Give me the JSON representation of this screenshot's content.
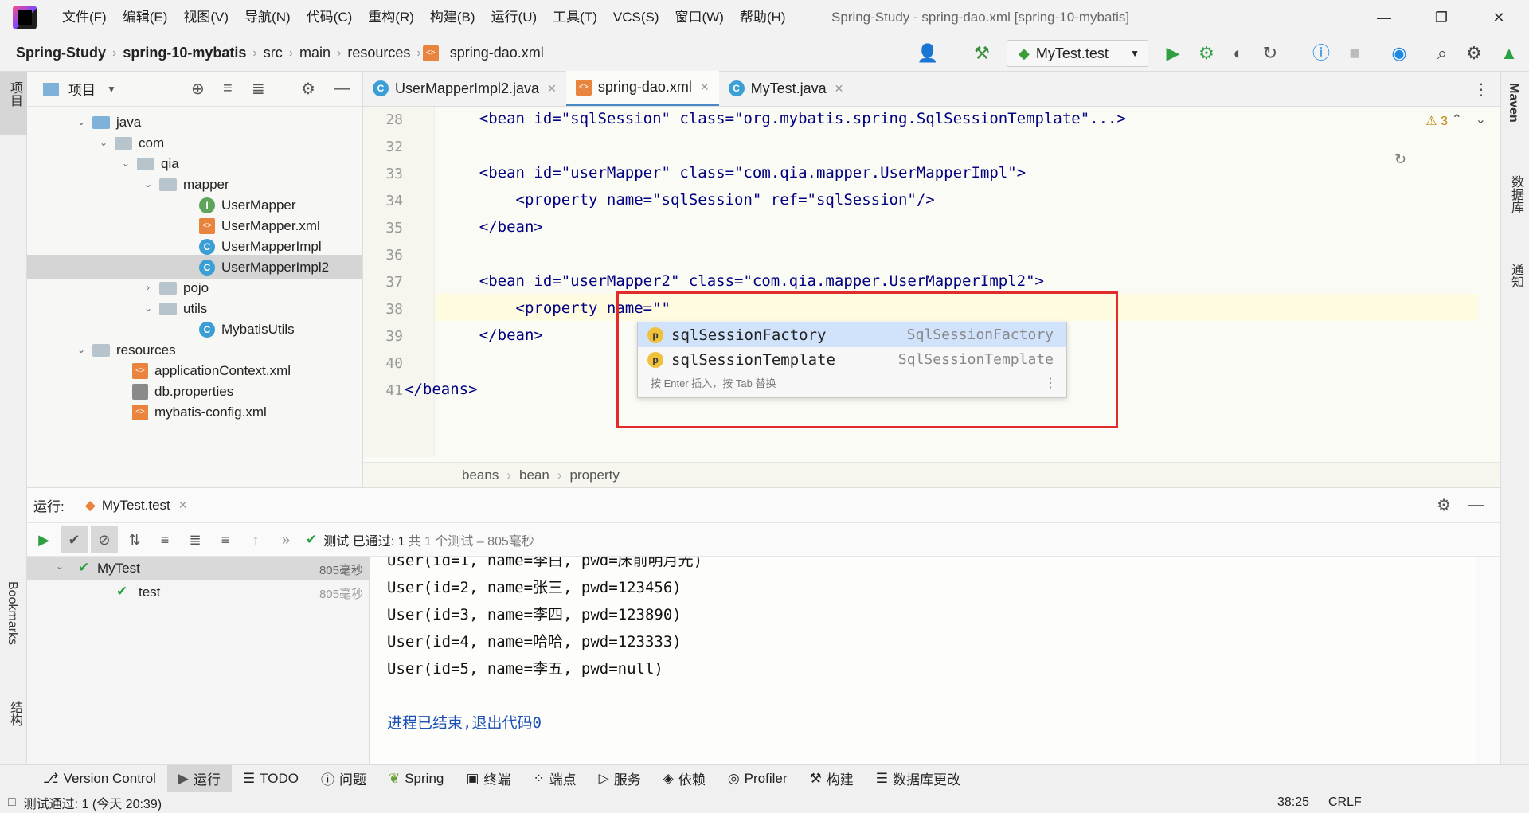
{
  "menu": [
    "文件(F)",
    "编辑(E)",
    "视图(V)",
    "导航(N)",
    "代码(C)",
    "重构(R)",
    "构建(B)",
    "运行(U)",
    "工具(T)",
    "VCS(S)",
    "窗口(W)",
    "帮助(H)"
  ],
  "window_title": "Spring-Study - spring-dao.xml [spring-10-mybatis]",
  "breadcrumb": [
    "Spring-Study",
    "spring-10-mybatis",
    "src",
    "main",
    "resources",
    "spring-dao.xml"
  ],
  "run_config": "MyTest.test",
  "left_strip": {
    "project": "项目",
    "bookmarks": "Bookmarks",
    "structure": "结构"
  },
  "right_strip": {
    "maven": "Maven",
    "database": "数据库",
    "notifications": "通知"
  },
  "project_panel": {
    "title": "项目",
    "tree": [
      {
        "label": "java",
        "type": "folder-blue",
        "expanded": true
      },
      {
        "label": "com",
        "type": "folder",
        "expanded": true
      },
      {
        "label": "qia",
        "type": "folder",
        "expanded": true
      },
      {
        "label": "mapper",
        "type": "folder",
        "expanded": true
      },
      {
        "label": "UserMapper",
        "type": "interface"
      },
      {
        "label": "UserMapper.xml",
        "type": "xml"
      },
      {
        "label": "UserMapperImpl",
        "type": "class"
      },
      {
        "label": "UserMapperImpl2",
        "type": "class",
        "selected": true
      },
      {
        "label": "pojo",
        "type": "folder",
        "expanded": false
      },
      {
        "label": "utils",
        "type": "folder",
        "expanded": true
      },
      {
        "label": "MybatisUtils",
        "type": "class"
      },
      {
        "label": "resources",
        "type": "folder",
        "expanded": true
      },
      {
        "label": "applicationContext.xml",
        "type": "xml"
      },
      {
        "label": "db.properties",
        "type": "props"
      },
      {
        "label": "mybatis-config.xml",
        "type": "xml"
      }
    ]
  },
  "tabs": [
    {
      "label": "UserMapperImpl2.java",
      "icon": "class-icon",
      "active": false
    },
    {
      "label": "spring-dao.xml",
      "icon": "xml-icon",
      "active": true
    },
    {
      "label": "MyTest.java",
      "icon": "class-icon",
      "active": false
    }
  ],
  "editor": {
    "warnings": "3",
    "lines": [
      {
        "num": "28",
        "text": "    <bean id=\"sqlSession\" class=\"org.mybatis.spring.SqlSessionTemplate\"...>"
      },
      {
        "num": "32",
        "text": ""
      },
      {
        "num": "33",
        "text": "    <bean id=\"userMapper\" class=\"com.qia.mapper.UserMapperImpl\">"
      },
      {
        "num": "34",
        "text": "        <property name=\"sqlSession\" ref=\"sqlSession\"/>"
      },
      {
        "num": "35",
        "text": "    </bean>"
      },
      {
        "num": "36",
        "text": ""
      },
      {
        "num": "37",
        "text": "    <bean id=\"userMapper2\" class=\"com.qia.mapper.UserMapperImpl2\">"
      },
      {
        "num": "38",
        "text": "        <property name=\"\""
      },
      {
        "num": "39",
        "text": "    </bean>"
      },
      {
        "num": "40",
        "text": ""
      },
      {
        "num": "41",
        "text": "</beans>"
      }
    ],
    "breadcrumb": [
      "beans",
      "bean",
      "property"
    ]
  },
  "completion": {
    "items": [
      {
        "name": "sqlSessionFactory",
        "type": "SqlSessionFactory",
        "selected": true
      },
      {
        "name": "sqlSessionTemplate",
        "type": "SqlSessionTemplate",
        "selected": false
      }
    ],
    "hint": "按 Enter 插入，按 Tab 替换"
  },
  "run_panel": {
    "label": "运行:",
    "tab": "MyTest.test",
    "status": "测试 已通过: 1",
    "status_detail": "共 1 个测试 – 805毫秒",
    "tree": [
      {
        "name": "MyTest",
        "time": "805毫秒"
      },
      {
        "name": "test",
        "time": "805毫秒"
      }
    ],
    "console": [
      "User(id=1, name=李白, pwd=床前明月光)",
      "User(id=2, name=张三, pwd=123456)",
      "User(id=3, name=李四, pwd=123890)",
      "User(id=4, name=哈哈, pwd=123333)",
      "User(id=5, name=李五, pwd=null)",
      "",
      "进程已结束,退出代码0"
    ]
  },
  "bottom_tools": [
    "Version Control",
    "运行",
    "TODO",
    "问题",
    "Spring",
    "终端",
    "端点",
    "服务",
    "依赖",
    "Profiler",
    "构建",
    "数据库更改"
  ],
  "status": {
    "message": "测试通过: 1 (今天 20:39)",
    "position": "38:25",
    "line_sep": "CRLF"
  }
}
